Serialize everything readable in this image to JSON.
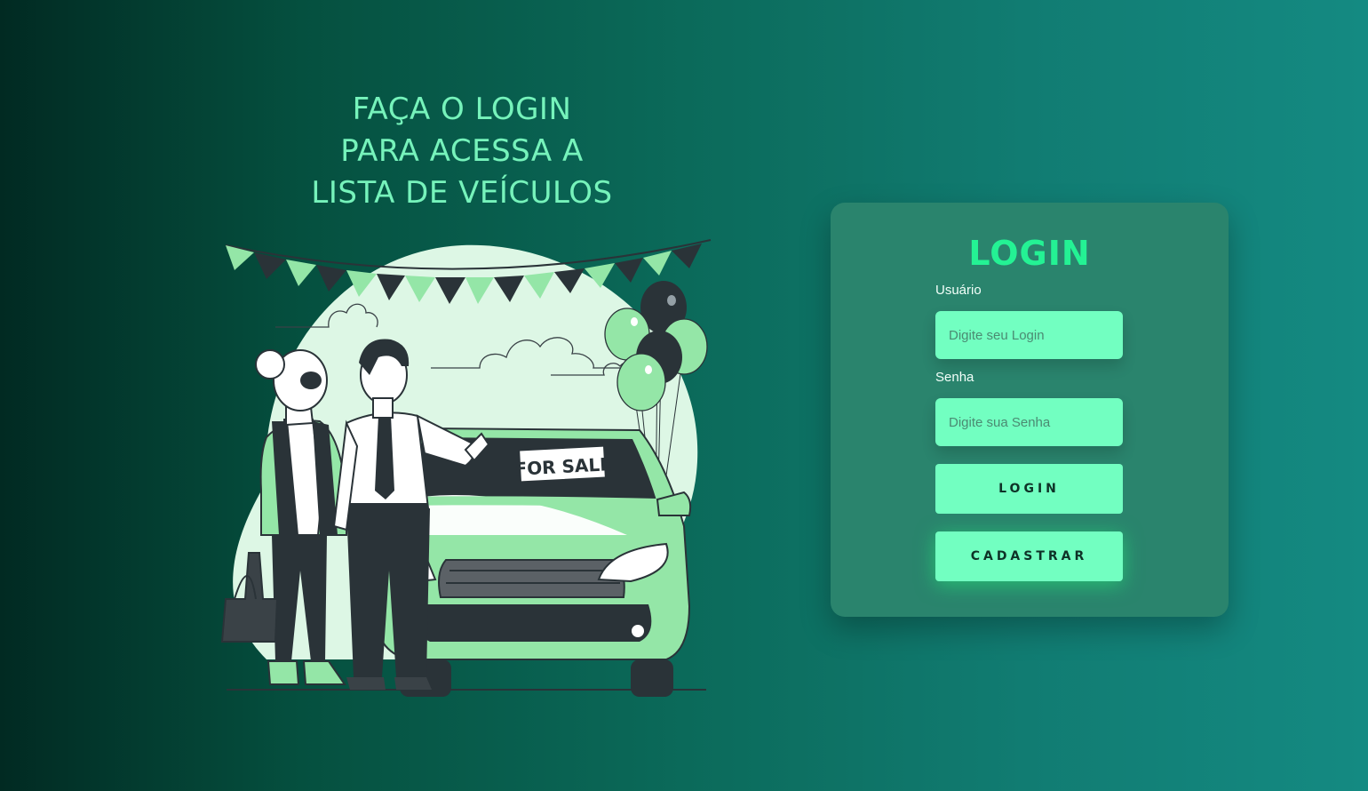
{
  "hero": {
    "title_lines": [
      "FAÇA O LOGIN",
      "PARA ACESSA A",
      "LISTA DE VEÍCULOS"
    ],
    "illustration_sign": "FOR SALE"
  },
  "login_card": {
    "title": "LOGIN",
    "username_label": "Usuário",
    "username_placeholder": "Digite seu Login",
    "username_value": "",
    "password_label": "Senha",
    "password_placeholder": "Digite sua Senha",
    "password_value": "",
    "login_button": "LOGIN",
    "register_button": "CADASTRAR"
  },
  "colors": {
    "accent": "#72ffc1",
    "title_green": "#24f294",
    "hero_text": "#76f3bb",
    "card_bg": "#2a846d"
  },
  "icons": [
    "balloons",
    "bunting-flags",
    "car",
    "clouds"
  ]
}
